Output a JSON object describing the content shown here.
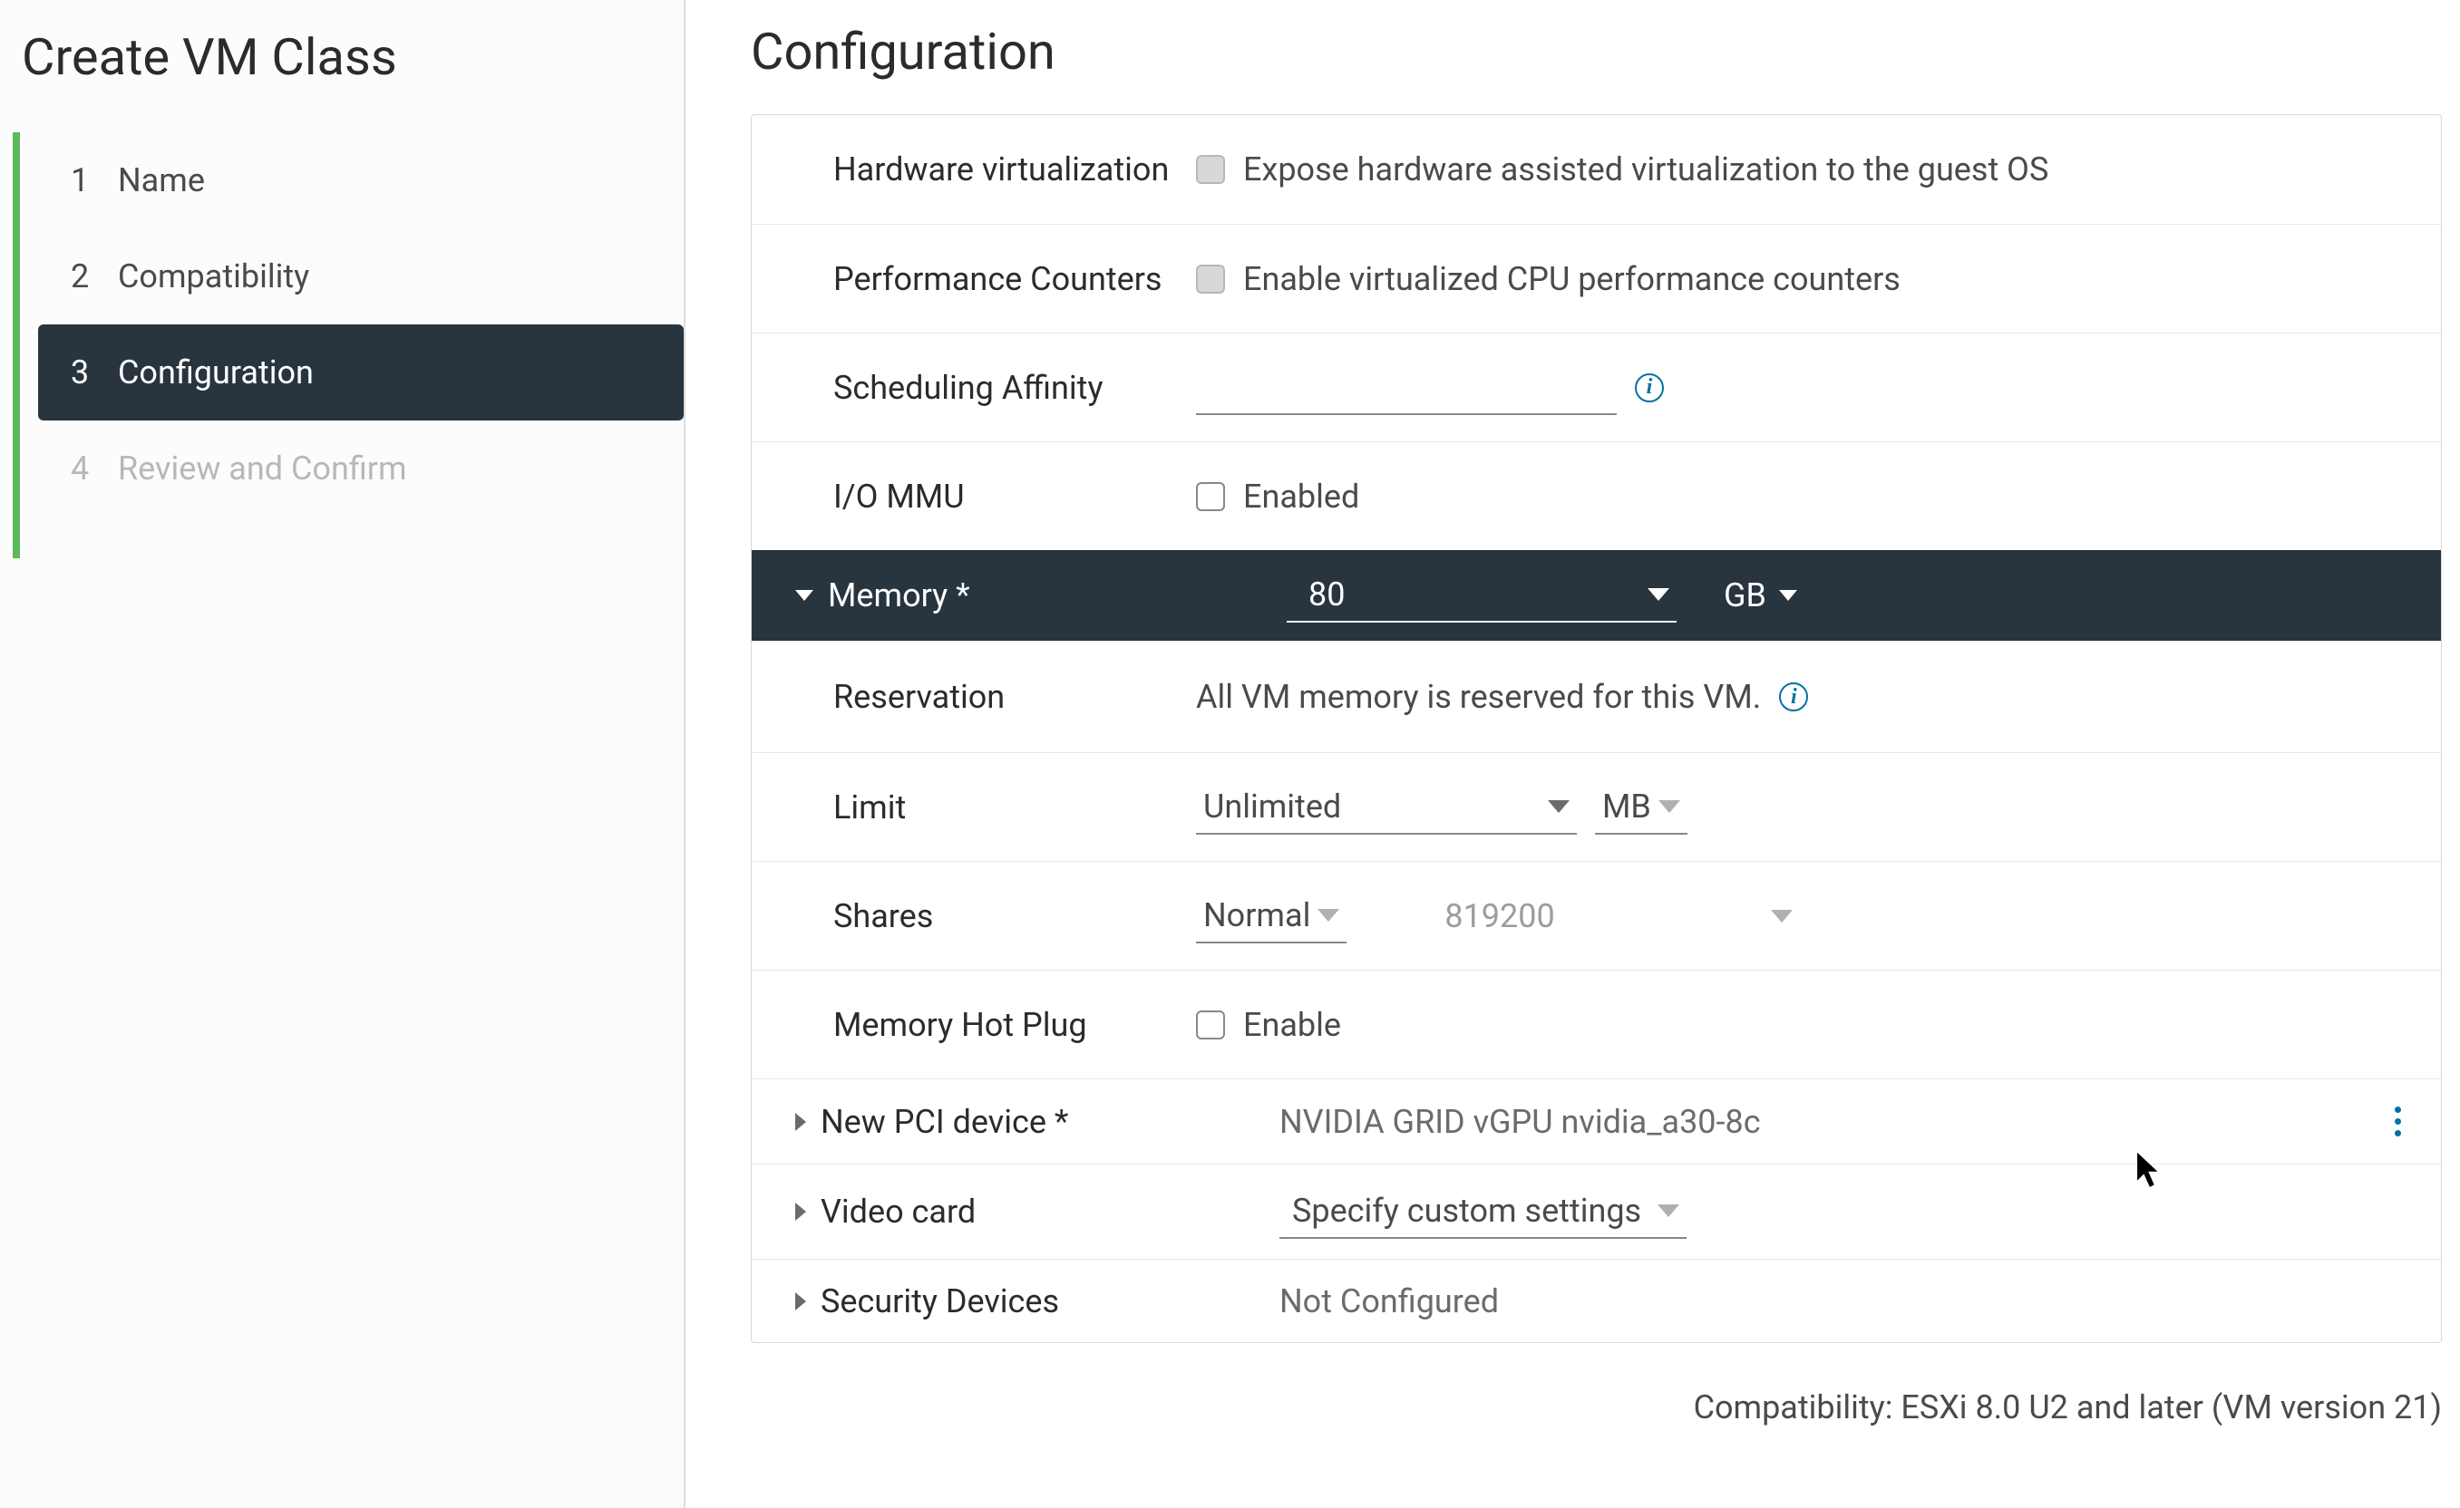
{
  "sidebar": {
    "title": "Create VM Class",
    "steps": [
      {
        "num": "1",
        "label": "Name"
      },
      {
        "num": "2",
        "label": "Compatibility"
      },
      {
        "num": "3",
        "label": "Configuration"
      },
      {
        "num": "4",
        "label": "Review and Confirm"
      }
    ]
  },
  "main": {
    "title": "Configuration",
    "hw_virt": {
      "label": "Hardware virtualization",
      "option": "Expose hardware assisted virtualization to the guest OS"
    },
    "perf_counters": {
      "label": "Performance Counters",
      "option": "Enable virtualized CPU performance counters"
    },
    "sched_affinity": {
      "label": "Scheduling Affinity",
      "value": ""
    },
    "io_mmu": {
      "label": "I/O MMU",
      "option": "Enabled"
    },
    "memory": {
      "label": "Memory *",
      "value": "80",
      "unit": "GB",
      "reservation_label": "Reservation",
      "reservation_text": "All VM memory is reserved for this VM.",
      "limit_label": "Limit",
      "limit_value": "Unlimited",
      "limit_unit": "MB",
      "shares_label": "Shares",
      "shares_level": "Normal",
      "shares_value": "819200",
      "hotplug_label": "Memory Hot Plug",
      "hotplug_option": "Enable"
    },
    "pci": {
      "label": "New PCI device *",
      "value": "NVIDIA GRID vGPU nvidia_a30-8c"
    },
    "video": {
      "label": "Video card",
      "value": "Specify custom settings"
    },
    "security": {
      "label": "Security Devices",
      "value": "Not Configured"
    },
    "footer_compat": "Compatibility: ESXi 8.0 U2 and later (VM version 21)"
  }
}
